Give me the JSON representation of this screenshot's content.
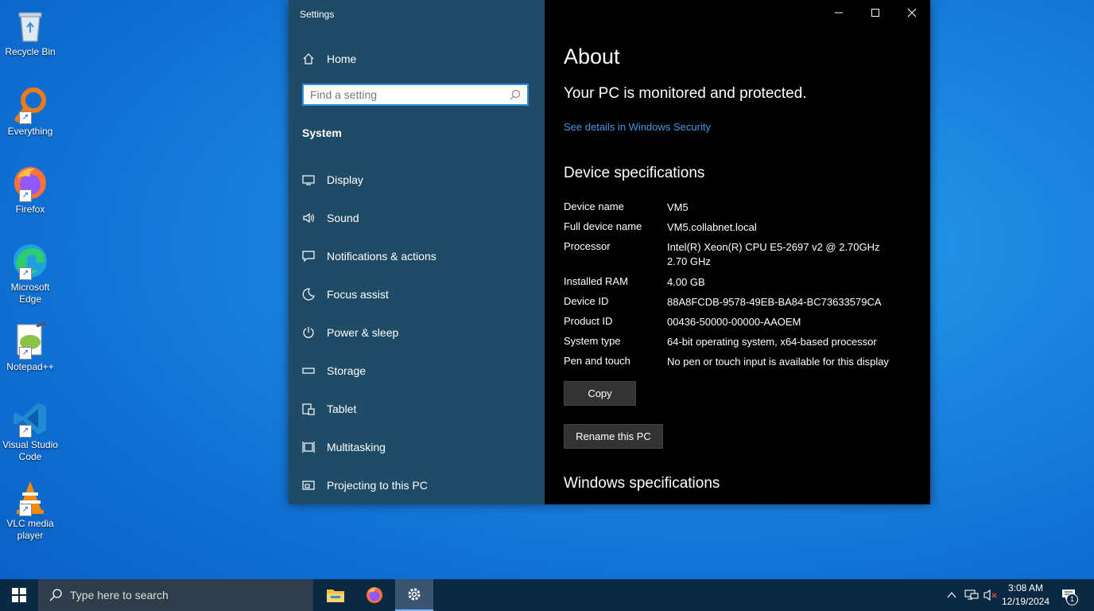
{
  "desktop": {
    "icons": [
      {
        "label": "Recycle Bin"
      },
      {
        "label": "Everything"
      },
      {
        "label": "Firefox"
      },
      {
        "label": "Microsoft Edge"
      },
      {
        "label": "Notepad++"
      },
      {
        "label": "Visual Studio Code"
      },
      {
        "label": "VLC media player"
      }
    ]
  },
  "window": {
    "title": "Settings",
    "controls": {
      "minimize": "minimize-icon",
      "maximize": "maximize-icon",
      "close": "close-icon"
    }
  },
  "nav": {
    "home_label": "Home",
    "search_placeholder": "Find a setting",
    "section": "System",
    "items": [
      {
        "label": "Display",
        "icon": "display-icon"
      },
      {
        "label": "Sound",
        "icon": "sound-icon"
      },
      {
        "label": "Notifications & actions",
        "icon": "notifications-icon"
      },
      {
        "label": "Focus assist",
        "icon": "moon-icon"
      },
      {
        "label": "Power & sleep",
        "icon": "power-icon"
      },
      {
        "label": "Storage",
        "icon": "storage-icon"
      },
      {
        "label": "Tablet",
        "icon": "tablet-icon"
      },
      {
        "label": "Multitasking",
        "icon": "multitasking-icon"
      },
      {
        "label": "Projecting to this PC",
        "icon": "projecting-icon"
      }
    ]
  },
  "about": {
    "title": "About",
    "status": "Your PC is monitored and protected.",
    "security_link": "See details in Windows Security",
    "device_specs_heading": "Device specifications",
    "specs": [
      {
        "key": "Device name",
        "value": "VM5"
      },
      {
        "key": "Full device name",
        "value": "VM5.collabnet.local"
      },
      {
        "key": "Processor",
        "value": "Intel(R) Xeon(R) CPU E5-2697 v2 @ 2.70GHz",
        "value2": "2.70 GHz"
      },
      {
        "key": "Installed RAM",
        "value": "4.00 GB"
      },
      {
        "key": "Device ID",
        "value": "88A8FCDB-9578-49EB-BA84-BC73633579CA"
      },
      {
        "key": "Product ID",
        "value": "00436-50000-00000-AAOEM"
      },
      {
        "key": "System type",
        "value": "64-bit operating system, x64-based processor"
      },
      {
        "key": "Pen and touch",
        "value": "No pen or touch input is available for this display"
      }
    ],
    "copy_button": "Copy",
    "rename_button": "Rename this PC",
    "windows_specs_heading": "Windows specifications"
  },
  "taskbar": {
    "search_placeholder": "Type here to search",
    "time": "3:08 AM",
    "date": "12/19/2024",
    "notification_count": "1",
    "accent": "#7cb7f0"
  }
}
